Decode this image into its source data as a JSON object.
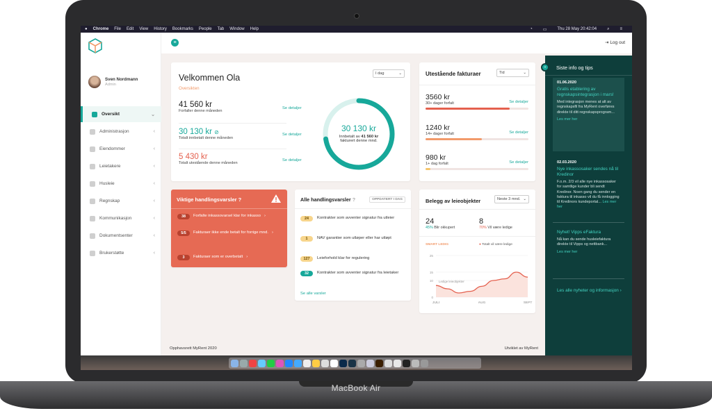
{
  "menubar": {
    "apple": "",
    "app": "Chrome",
    "items": [
      "File",
      "Edit",
      "View",
      "History",
      "Bookmarks",
      "People",
      "Tab",
      "Window",
      "Help"
    ],
    "clock": "Thu 28 May  20:42:04"
  },
  "sidebar": {
    "user_name": "Sven Nordmann",
    "user_role": "Admin",
    "items": [
      {
        "label": "Oversikt",
        "active": true
      },
      {
        "label": "Administrasjon"
      },
      {
        "label": "Eiendommer"
      },
      {
        "label": "Leietakere"
      },
      {
        "label": "Husleie"
      },
      {
        "label": "Regnskap"
      },
      {
        "label": "Kommunikasjon"
      },
      {
        "label": "Dokumentsenter"
      },
      {
        "label": "Brukerstøtte"
      }
    ]
  },
  "topbar": {
    "logout": "Log out"
  },
  "welcome": {
    "title": "Velkommen Ola",
    "subtitle": "Oversikten",
    "select": "I dag",
    "rows": [
      {
        "amount": "41 560 kr",
        "label": "Forfaller denne måneden",
        "link": "Se detaljer",
        "color": "#222222"
      },
      {
        "amount": "30 130 kr",
        "label": "Totalt innbetalt denne måneden",
        "link": "Se detaljer",
        "color": "#17a89a"
      },
      {
        "amount": "5 430 kr",
        "label": "Totalt utestående denne måneden",
        "link": "Se detaljer",
        "color": "#e4604e"
      }
    ],
    "donut": {
      "value": "30 130 kr",
      "line1": "Innbetalt av",
      "line1_bold": "41 560 kr",
      "line2": "fakturert denne mnd.",
      "progress": 0.725
    }
  },
  "invoices": {
    "title": "Utestående fakturaer",
    "select": "Tid",
    "rows": [
      {
        "amount": "3560 kr",
        "label": "30+ dager forfalt",
        "link": "Se detaljer",
        "fill": 0.82,
        "color": "#e4604e"
      },
      {
        "amount": "1240 kr",
        "label": "14+ dager forfalt",
        "link": "Se detaljer",
        "fill": 0.55,
        "color": "#f29a6a"
      },
      {
        "amount": "980 kr",
        "label": "1+ dag forfalt",
        "link": "Se detaljer",
        "fill": 0.05,
        "color": "#f5c56a"
      }
    ]
  },
  "important": {
    "title": "Viktige handlingsvarsler",
    "items": [
      {
        "badge": "38",
        "text": "Forfalte inkassovarsel klar for inkasso"
      },
      {
        "badge": "5/5",
        "text": "Fakturaer ikke ende betalt for forrige mnd."
      },
      {
        "badge": "3",
        "text": "Fakturaer som er overbetalt"
      }
    ]
  },
  "all_alerts": {
    "title": "Alle handlingsvarsler",
    "tag": "OPPDATERT I DAG",
    "items": [
      {
        "badge": "24",
        "text": "Kontrakter som avventer signatur fra utleier",
        "color": "#f7d58c"
      },
      {
        "badge": "1",
        "text": "NAV garantier som utløper eller har utløpt",
        "color": "#f7d58c"
      },
      {
        "badge": "127",
        "text": "Leieforhold klar for regulering",
        "color": "#f7d58c"
      },
      {
        "badge": "32",
        "text": "Kontrakter som avventer signatur fra leietaker",
        "color": "#17a89a"
      }
    ],
    "link": "Se alle varsler"
  },
  "occupancy": {
    "title": "Belegg av leieobjekter",
    "select": "Neste 3 mnd.",
    "stat1": {
      "value": "24",
      "pct": "45%",
      "label": "Blir okkupert"
    },
    "stat2": {
      "value": "8",
      "pct": "70%",
      "label": "Vil være ledige"
    },
    "chart_label": "SMART LEDIG",
    "legend": "Totalt vil være ledige"
  },
  "chart_data": {
    "type": "area",
    "categories": [
      "JULI",
      "AUG",
      "SEPT"
    ],
    "x": [
      0,
      0.25,
      0.5,
      0.75,
      1,
      1.25,
      1.5,
      1.75,
      2
    ],
    "values": [
      7,
      5,
      2.5,
      3.5,
      6.5,
      10,
      11,
      15,
      12
    ],
    "ylim": [
      0,
      25
    ],
    "yticks": [
      0,
      10,
      15,
      25
    ],
    "series": [
      {
        "name": "Ledige",
        "values": [
          7,
          5,
          2.5,
          3.5,
          6.5,
          10,
          11,
          15,
          12
        ]
      }
    ],
    "annotation": "Ledige leieobjekter"
  },
  "panel": {
    "title": "Siste info og tips",
    "news": [
      {
        "date": "01.06.2020",
        "head": "Gratis etablering av regnskapsintegrasjon i mars!",
        "text": "Med integrasjon menes at alt av regnskapsfil fra MyRent overføres direkte til ditt regnskapsprogram...",
        "link": "Les mer her"
      },
      {
        "date": "02.03.2020",
        "head": "Nye inkassosaker sendes nå til Kredinor",
        "text": "F.o.m. 2/3 vil alle nye inkassosaker for samtlige kunder bli sendt Kredinor. Noen gang du sender en faktura til inkasso vil du få innlogging til Kredinors kundeportal...",
        "link": "Les mer her"
      },
      {
        "date": "",
        "head": "Nyhet! Vipps eFaktura",
        "text": "Nå kan du sende husleiefaktura direkte til Vipps og nettbank...",
        "link": "Les mer her"
      }
    ],
    "all_link": "Les alle nyheter og informasjon"
  },
  "footer": {
    "left": "Opphavsrett MyRent 2020",
    "right": "Utviklet av MyRent"
  },
  "device_label": "MacBook Air",
  "accent": "#17a89a"
}
